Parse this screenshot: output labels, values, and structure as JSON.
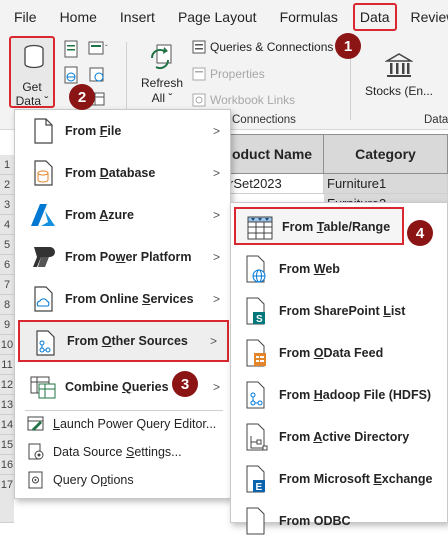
{
  "menubar": {
    "tabs": [
      "File",
      "Home",
      "Insert",
      "Page Layout",
      "Formulas",
      "Data",
      "Review"
    ],
    "active_tab": "Data"
  },
  "ribbon": {
    "get_data_label_1": "Get",
    "get_data_label_2": "Data",
    "refresh_label_1": "Refresh",
    "refresh_label_2": "All",
    "queries_connections": "Queries & Connections",
    "properties": "Properties",
    "workbook_links": "Workbook Links",
    "connections_group": "Connections",
    "stocks": "Stocks (En...",
    "data_group_partial": "Data"
  },
  "sheet": {
    "rows": [
      "1",
      "2",
      "3",
      "4",
      "5",
      "6",
      "7",
      "8",
      "9",
      "10",
      "11",
      "12",
      "13",
      "14",
      "15",
      "16",
      "17"
    ],
    "headers": {
      "product": "oduct Name",
      "category": "Category"
    },
    "cells": [
      {
        "product": "rSet2023",
        "category": "Furniture1"
      },
      {
        "product": "",
        "category": "Furniture2"
      }
    ]
  },
  "menu": {
    "from_file": {
      "pre": "From ",
      "key": "F",
      "post": "ile"
    },
    "from_database": {
      "pre": "From ",
      "key": "D",
      "post": "atabase"
    },
    "from_azure": {
      "pre": "From ",
      "key": "A",
      "post": "zure"
    },
    "from_power_platform": {
      "pre": "From Po",
      "key": "w",
      "post": "er Platform"
    },
    "from_online_services": {
      "pre": "From Online ",
      "key": "S",
      "post": "ervices"
    },
    "from_other_sources": {
      "pre": "From ",
      "key": "O",
      "post": "ther Sources"
    },
    "combine_queries": {
      "pre": "Combine ",
      "key": "Q",
      "post": "ueries"
    },
    "launch_editor": {
      "pre": "",
      "key": "L",
      "post": "aunch Power Query Editor..."
    },
    "data_source_settings": {
      "pre": "Data Source ",
      "key": "S",
      "post": "ettings..."
    },
    "query_options": {
      "pre": "Query O",
      "key": "p",
      "post": "tions"
    },
    "arrow": ">"
  },
  "submenu": {
    "from_table_range": {
      "pre": "From ",
      "key": "T",
      "post": "able/Range"
    },
    "from_web": {
      "pre": "From ",
      "key": "W",
      "post": "eb"
    },
    "from_sharepoint_list": {
      "pre": "From SharePoint ",
      "key": "L",
      "post": "ist"
    },
    "from_odata_feed": {
      "pre": "From ",
      "key": "O",
      "post": "Data Feed"
    },
    "from_hadoop": {
      "pre": "From ",
      "key": "H",
      "post": "adoop File (HDFS)"
    },
    "from_active_directory": {
      "pre": "From ",
      "key": "A",
      "post": "ctive Directory"
    },
    "from_exchange": {
      "pre": "From Microsoft ",
      "key": "E",
      "post": "xchange"
    },
    "from_odbc": {
      "pre": "From ODBC",
      "key": "",
      "post": ""
    }
  },
  "badges": [
    "1",
    "2",
    "3",
    "4"
  ],
  "colors": {
    "highlight_red": "#d9282f",
    "badge": "#8b1414",
    "excel_green": "#217346",
    "azure_blue": "#0078d4",
    "orange": "#e3862b"
  }
}
